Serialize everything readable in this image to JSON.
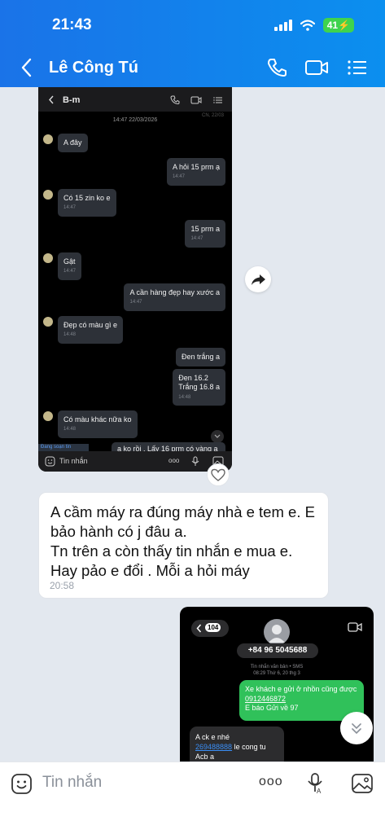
{
  "status_bar": {
    "time": "21:43",
    "battery": "41"
  },
  "header": {
    "title": "Lê Công Tú",
    "back_icon": "chevron-left-icon",
    "icons": [
      "phone-icon",
      "video-call-icon",
      "menu-list-icon"
    ]
  },
  "screenshot1": {
    "title": "B-m",
    "meta_right": "CN, 22/03",
    "date": "14:47 22/03/2026",
    "messages": [
      {
        "side": "in",
        "text": "A đây",
        "time": ""
      },
      {
        "side": "out",
        "text": "A hỏi 15 prm ạ",
        "time": "14:47"
      },
      {
        "side": "in",
        "text": "Có 15 zin ko e",
        "time": "14:47"
      },
      {
        "side": "out",
        "text": "15 prm a",
        "time": "14:47"
      },
      {
        "side": "in",
        "text": "Gật",
        "time": "14:47"
      },
      {
        "side": "out",
        "text": "A cần hàng đẹp hay xước a",
        "time": "14:47"
      },
      {
        "side": "in",
        "text": "Đẹp có màu gì e",
        "time": "14:48"
      },
      {
        "side": "out",
        "text": "Đen trắng a",
        "time": ""
      },
      {
        "side": "out",
        "text": "Đen 16.2\nTrắng 16.8 a",
        "time": "14:48"
      },
      {
        "side": "in",
        "text": "Có màu khác nữa ko",
        "time": "14:48"
      }
    ],
    "typing": "Đang soạn tin",
    "partial_message": "a ko rồi . Lấy 16 prm có vàng a",
    "composer_placeholder": "Tin nhắn",
    "composer_dots": "ooo"
  },
  "message": {
    "text": "A cầm máy ra đúng máy nhà e tem e.  E bảo hành có j đâu a.\nTn trên a còn thấy tin nhắn e mua e.\nHay pảo e đổi . Mỗi a hỏi máy",
    "time": "20:58"
  },
  "screenshot2": {
    "back_badge": "104",
    "phone_number": "+84 96 5045688",
    "sub_type": "Tin nhắn văn bản • SMS",
    "sub_time": "08:29 Thứ 6, 20 thg 3",
    "green_text_1": "Xe khách e gửi ở nhồn cũng được",
    "green_link": "0912446872",
    "green_text_2": "E báo Gửi về 97",
    "gray_line_1": "A ck e nhé",
    "gray_link": "269488888",
    "gray_after_link": " le cong tu",
    "gray_line_3": "Acb a"
  },
  "composer": {
    "placeholder": "Tin nhắn",
    "dots": "ooo",
    "icons": [
      "sticker-icon",
      "more-icon",
      "voice-text-icon",
      "image-icon"
    ]
  },
  "colors": {
    "header": "#1a73e8",
    "bg": "#e3e8ef",
    "sms_green": "#30c15a"
  }
}
